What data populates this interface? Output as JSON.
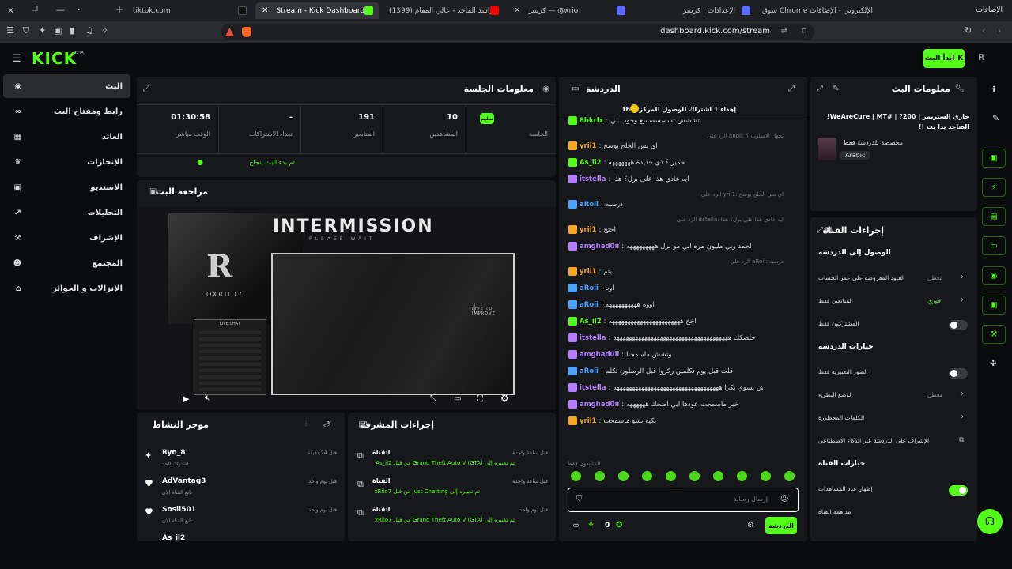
{
  "browser": {
    "tabs": [
      {
        "title": "tiktok.com",
        "active": false
      },
      {
        "title": "Stream - Kick Dashboard",
        "active": true
      },
      {
        "title": "(1399) راشد الماجد - عالي المقام - (...",
        "active": false
      },
      {
        "title": "كريتير — @xrio",
        "active": false
      },
      {
        "title": "الإعدادات | كريتير",
        "active": false
      },
      {
        "title": "سوق Chrome الإلكتروني - الإضافات",
        "active": false
      }
    ],
    "extensions_label": "الإضافات",
    "url": "dashboard.kick.com/stream"
  },
  "topbar": {
    "logo": "KICK",
    "logo_sup": "BETA",
    "go_live": "ابدأ البث"
  },
  "sidebar": {
    "items": [
      {
        "label": "البث",
        "icon": "broadcast-icon",
        "active": true,
        "chevron": false
      },
      {
        "label": "رابط ومفتاح البث",
        "icon": "link-icon",
        "active": false,
        "chevron": false
      },
      {
        "label": "العائد",
        "icon": "revenue-icon",
        "active": false,
        "chevron": false
      },
      {
        "label": "الإنجازات",
        "icon": "trophy-icon",
        "active": false,
        "chevron": false
      },
      {
        "label": "الاستديو",
        "icon": "studio-icon",
        "active": false,
        "chevron": true
      },
      {
        "label": "التحليلات",
        "icon": "analytics-icon",
        "active": false,
        "chevron": true
      },
      {
        "label": "الإشراف",
        "icon": "moderation-icon",
        "active": false,
        "chevron": false
      },
      {
        "label": "المجتمع",
        "icon": "community-icon",
        "active": false,
        "chevron": true
      },
      {
        "label": "الإنزالات و الجوائز",
        "icon": "drops-icon",
        "active": false,
        "chevron": false
      }
    ]
  },
  "session": {
    "title": "معلومات الجلسة",
    "status_badge": "سليم",
    "status_label": "الجلسة",
    "stats": [
      {
        "value": "10",
        "label": "المشاهدين"
      },
      {
        "value": "191",
        "label": "المتابعين"
      },
      {
        "value": "-",
        "label": "تعداد الاشتراكات"
      },
      {
        "value": "01:30:58",
        "label": "الوقت مباشر"
      }
    ],
    "success_msg": "تم بدء البث بنجاح"
  },
  "preview": {
    "title": "مراجعة البث",
    "intermission": "INTERMISSION",
    "please_wait": "PLEASE WAIT",
    "brand": "OXRIIO7",
    "live_chat": "LIVE CHAT",
    "live_to_improve": "LIVE TO IMPROVE"
  },
  "activity": {
    "title": "موجز النشاط",
    "items": [
      {
        "name": "Ryn_8",
        "desc": "اشتراك الحد",
        "time": "قبل 24 دقيقة"
      },
      {
        "name": "AdVantag3",
        "desc": "تابع القناة الان",
        "time": "قبل يوم واحد"
      },
      {
        "name": "Sosil501",
        "desc": "تابع القناة الان",
        "time": "قبل يوم واحد"
      },
      {
        "name": "As_il2",
        "desc": "",
        "time": ""
      }
    ]
  },
  "modactions": {
    "title": "إجراءات المشرف",
    "items": [
      {
        "head": "القناة",
        "text": "تم تغييره إلى Grand Theft Auto V (GTA) من قبل As_il2",
        "time": "قبل ساعة واحدة"
      },
      {
        "head": "القناة",
        "text": "تم تغييره إلى Just Chatting من قبل xRiio7",
        "time": "قبل ساعة واحدة"
      },
      {
        "head": "القناة",
        "text": "تم تغييره إلى Grand Theft Auto V (GTA) من قبل xRiio7",
        "time": "قبل يوم واحد"
      }
    ]
  },
  "chat": {
    "title": "الدردشة",
    "pinned": "إهداء 1 اشتراك للوصول للمركز 1 th",
    "messages": [
      {
        "user": "8bkrlx",
        "text": "تششش تسسسسسع وجوب لي",
        "color": "#53fc18",
        "reply": ""
      },
      {
        "user": "yrii1",
        "text": "اي بس الخلج يوسخ",
        "color": "#f5a623",
        "reply": "بجهل الاسلوب ؟ :aRoii الرد على"
      },
      {
        "user": "As_il2",
        "text": "حمير ؟ ذي جديدة هههههههه",
        "color": "#53fc18",
        "reply": ""
      },
      {
        "user": "itstella",
        "text": "ايه عادي هذا على برل؟ هذا",
        "color": "#b47cff",
        "reply": ""
      },
      {
        "user": "aRoii",
        "text": "درسيه",
        "color": "#4aa3ff",
        "reply": "اي بس الخلج يوسخ :yrii1 الرد على"
      },
      {
        "user": "yrii1",
        "text": "احتج",
        "color": "#f5a623",
        "reply": "ايه عادي هذا على برل؟ هذا :itstella الرد على"
      },
      {
        "user": "amghad0ii",
        "text": "لحمد ربي مليون مره اني مو برل هههههههههه",
        "color": "#b47cff",
        "reply": ""
      },
      {
        "user": "yrii1",
        "text": "يتم",
        "color": "#f5a623",
        "reply": "درسيه :aRoii الرد على"
      },
      {
        "user": "aRoii",
        "text": "اوه",
        "color": "#4aa3ff",
        "reply": ""
      },
      {
        "user": "aRoii",
        "text": "اووه ههههههههههه",
        "color": "#4aa3ff",
        "reply": ""
      },
      {
        "user": "As_il2",
        "text": "اخخ هههههههههههههههههههههههه",
        "color": "#53fc18",
        "reply": ""
      },
      {
        "user": "itstella",
        "text": "خلصكك هههههههههههههههههههههههههههههههههههههه",
        "color": "#b47cff",
        "reply": ""
      },
      {
        "user": "amghad0ii",
        "text": "وتشش ماسمحنا",
        "color": "#b47cff",
        "reply": ""
      },
      {
        "user": "aRoii",
        "text": "قلت قبل يوم تكلمين ركزوا قبل الرسلون تكلم",
        "color": "#4aa3ff",
        "reply": ""
      },
      {
        "user": "itstella",
        "text": "على كثر ما تسمرت عليك مدري يش يسوي بكرا ههههههههههههههههههههههههههههههههههه",
        "color": "#b47cff",
        "reply": ""
      },
      {
        "user": "amghad0ii",
        "text": "خير ماسمحت عودها ابي اضحك ههههههه",
        "color": "#b47cff",
        "reply": ""
      },
      {
        "user": "yrii1",
        "text": "بكيه تشو ماسمحت",
        "color": "#f5a623",
        "reply": ""
      }
    ],
    "followers_only": "المتابعون فقط",
    "input_placeholder": "إرسال رسالة",
    "send_label": "الدردشة",
    "count_a": "0",
    "count_b": "0"
  },
  "streaminfo": {
    "title": "معلومات البث",
    "stream_title": "حاري الستريمر | 200? | #WeAreCure | MT! الصاعد يدا يت !!",
    "subtitle": "مخصصة للدردشة فقط",
    "language": "Arabic"
  },
  "channelactions": {
    "title": "إجراءات القناة",
    "sections": [
      {
        "header": "الوصول إلى الدردشة",
        "rows": [
          {
            "label": "القيود المفروضة على عمر الحساب",
            "value": "معطل",
            "control": "chevron"
          },
          {
            "label": "المتابعين فقط",
            "value": "فوري",
            "control": "chevron"
          },
          {
            "label": "المشتركون فقط",
            "value": "",
            "control": "toggle-off"
          }
        ]
      },
      {
        "header": "خيارات الدردشة",
        "rows": [
          {
            "label": "الصور التعبيرية فقط",
            "value": "",
            "control": "toggle-off"
          },
          {
            "label": "الوضع البطيء",
            "value": "معطل",
            "control": "chevron"
          },
          {
            "label": "الكلمات المحظورة",
            "value": "",
            "control": "chevron"
          },
          {
            "label": "الإشراف على الدردشة عبر الذكاء الاصطناعي",
            "value": "",
            "control": "external"
          }
        ]
      },
      {
        "header": "خيارات القناة",
        "rows": [
          {
            "label": "إظهار عدد المشاهدات",
            "value": "",
            "control": "toggle-on"
          },
          {
            "label": "مداهمة القناة",
            "value": "",
            "control": "none"
          }
        ]
      }
    ]
  },
  "colors": {
    "accent": "#53fc18",
    "panel": "#17181b",
    "bg": "#0b0c0e"
  }
}
